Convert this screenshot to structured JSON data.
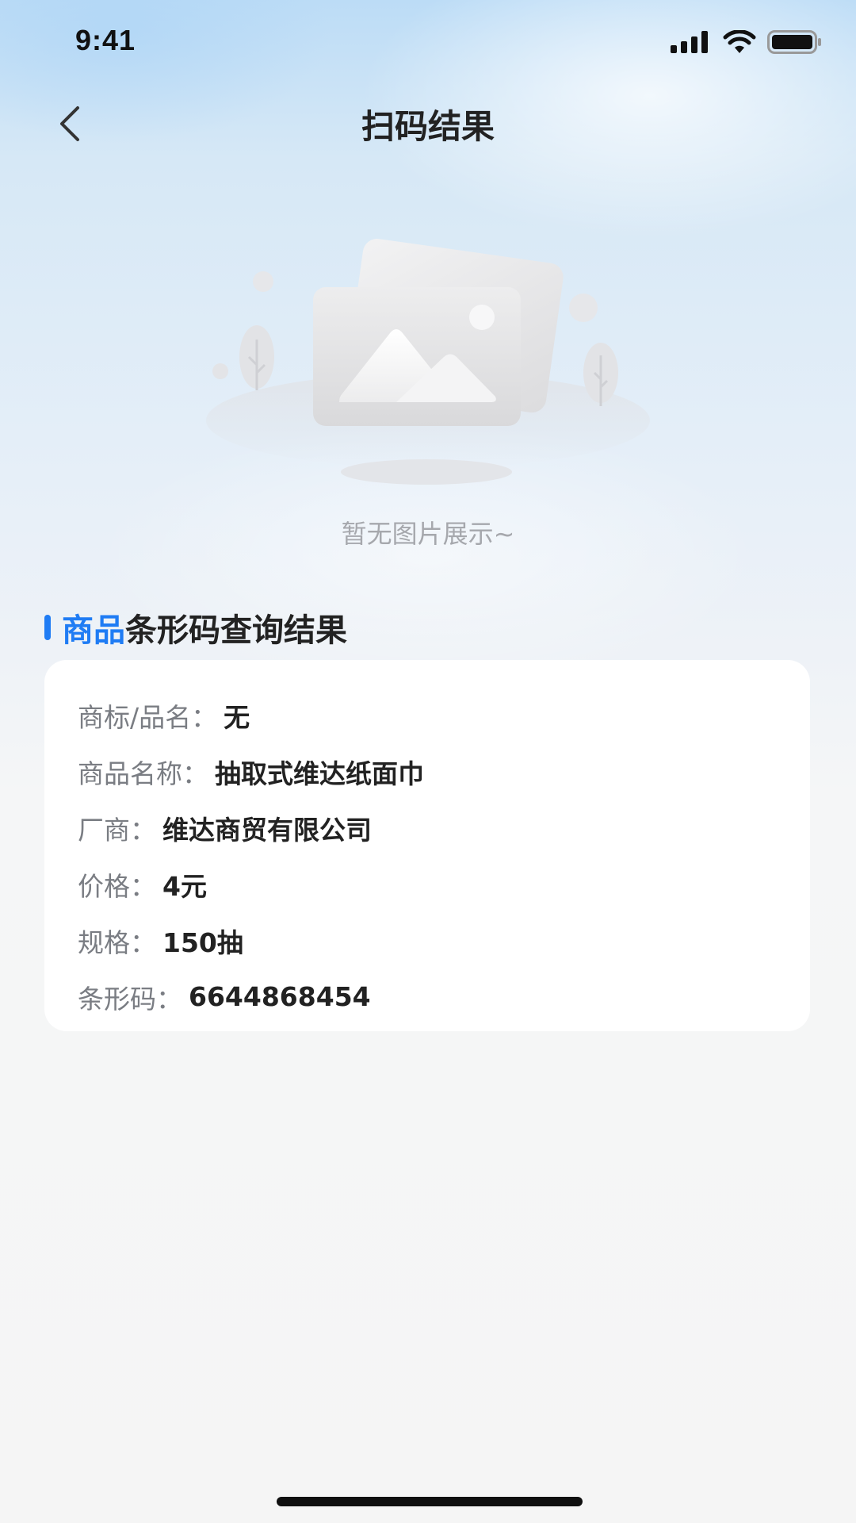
{
  "status_bar": {
    "time": "9:41",
    "icons": [
      "cellular-signal-icon",
      "wifi-icon",
      "battery-icon"
    ]
  },
  "nav": {
    "back_icon": "chevron-left-icon",
    "title": "扫码结果"
  },
  "empty_state": {
    "illustration": "image-placeholder-icon",
    "text": "暂无图片展示~"
  },
  "section": {
    "title_accent": "商品",
    "title_rest": "条形码查询结果",
    "accent_color": "#1f7cf4"
  },
  "result": {
    "rows": [
      {
        "label": "商标/品名：",
        "value": "无"
      },
      {
        "label": "商品名称：",
        "value": "抽取式维达纸面巾"
      },
      {
        "label": "厂商：",
        "value": "维达商贸有限公司"
      },
      {
        "label": "价格：",
        "value": "4元"
      },
      {
        "label": "规格：",
        "value": "150抽"
      },
      {
        "label": "条形码：",
        "value": "6644868454"
      }
    ]
  }
}
